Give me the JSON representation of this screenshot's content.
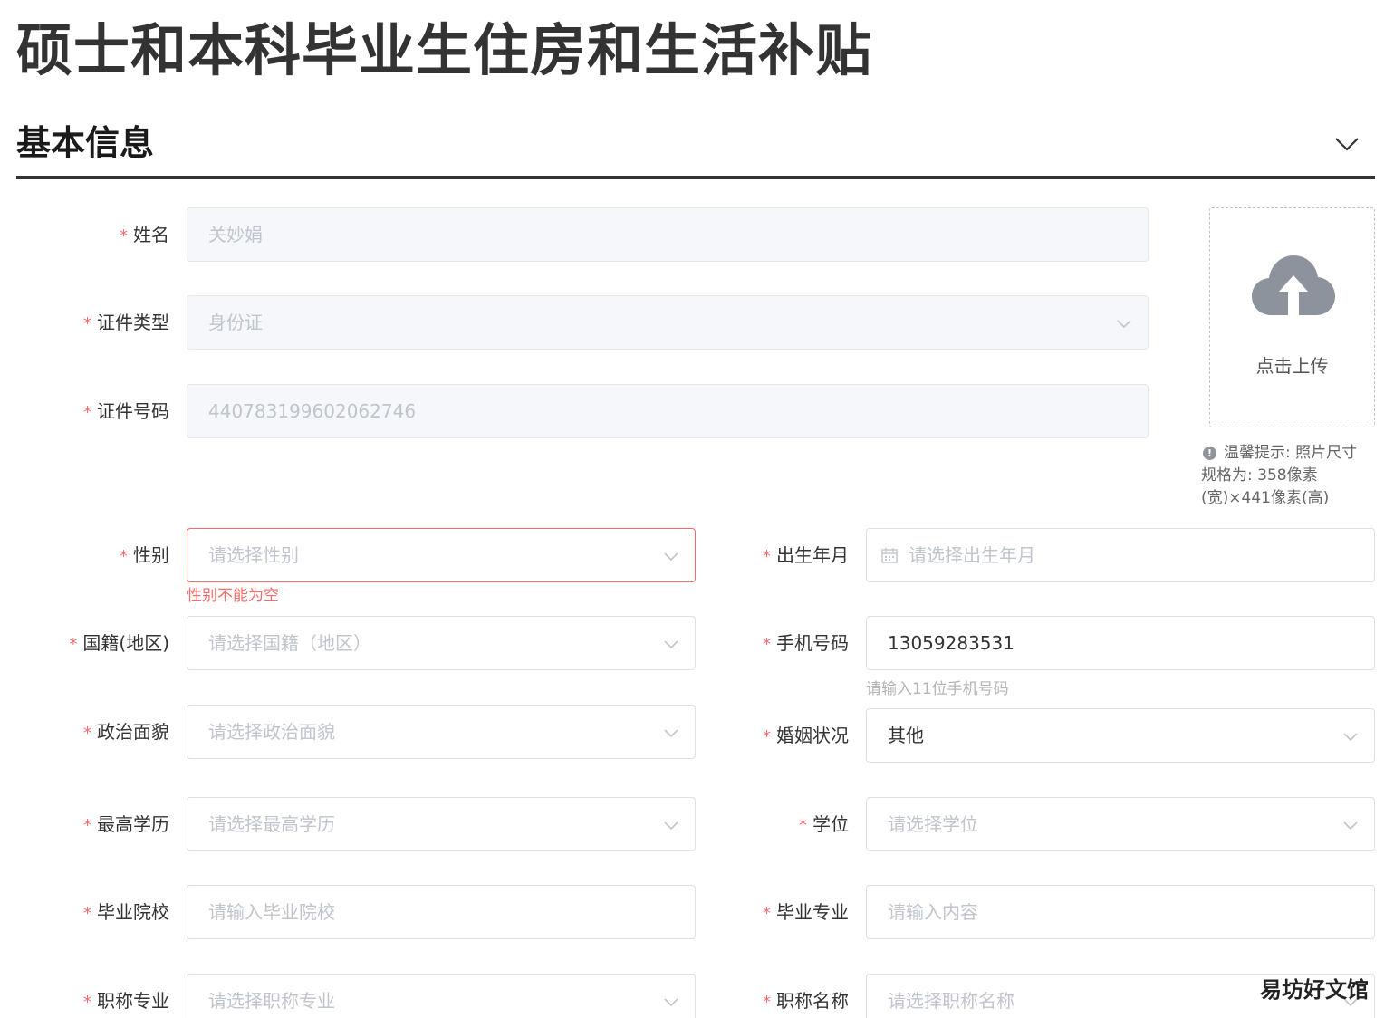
{
  "page": {
    "title": "硕士和本科毕业生住房和生活补贴"
  },
  "section": {
    "title": "基本信息"
  },
  "required_mark": "*",
  "fields": {
    "name": {
      "label": "姓名",
      "value": "关妙娟"
    },
    "id_type": {
      "label": "证件类型",
      "value": "身份证"
    },
    "id_number": {
      "label": "证件号码",
      "value": "440783199602062746"
    },
    "gender": {
      "label": "性别",
      "placeholder": "请选择性别",
      "error": "性别不能为空"
    },
    "birth": {
      "label": "出生年月",
      "placeholder": "请选择出生年月"
    },
    "nationality": {
      "label": "国籍(地区)",
      "placeholder": "请选择国籍（地区）"
    },
    "phone": {
      "label": "手机号码",
      "value": "13059283531",
      "hint": "请输入11位手机号码"
    },
    "political": {
      "label": "政治面貌",
      "placeholder": "请选择政治面貌"
    },
    "marital": {
      "label": "婚姻状况",
      "value": "其他"
    },
    "education": {
      "label": "最高学历",
      "placeholder": "请选择最高学历"
    },
    "degree": {
      "label": "学位",
      "placeholder": "请选择学位"
    },
    "school": {
      "label": "毕业院校",
      "placeholder": "请输入毕业院校"
    },
    "major": {
      "label": "毕业专业",
      "placeholder": "请输入内容"
    },
    "title_major": {
      "label": "职称专业",
      "placeholder": "请选择职称专业"
    },
    "title_name": {
      "label": "职称名称",
      "placeholder": "请选择职称名称"
    }
  },
  "upload": {
    "label": "点击上传",
    "tip_line1": "温馨提示: 照片尺寸",
    "tip_line2": "规格为: 358像素",
    "tip_line3": "(宽)×441像素(高)"
  },
  "watermark": "易坊好文馆",
  "icons": {
    "collapse": "chevron-down-icon",
    "select": "chevron-down-icon",
    "calendar": "calendar-icon",
    "upload": "cloud-upload-icon",
    "tip": "info-icon"
  },
  "colors": {
    "required": "#f56c6c",
    "error": "#f56c6c",
    "disabled_bg": "#f5f7fa",
    "border": "#dcdfe6",
    "placeholder": "#c0c4cc",
    "title": "#333333"
  }
}
